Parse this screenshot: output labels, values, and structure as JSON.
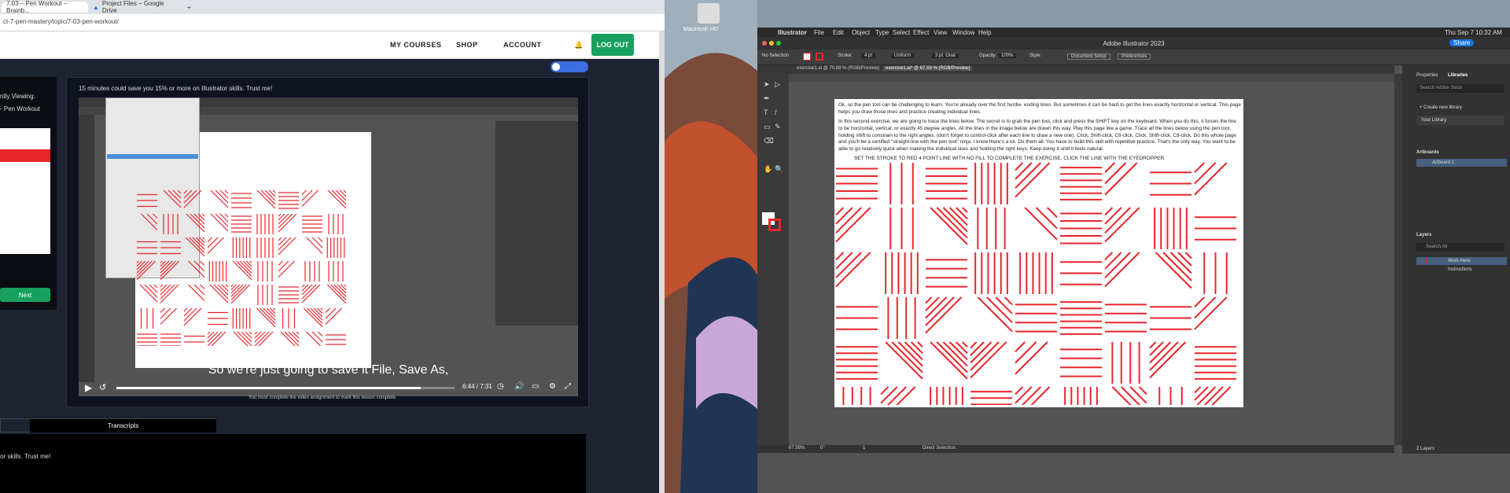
{
  "browser": {
    "tabs": [
      {
        "label": "7.03 – Pen Workout – Brainb..."
      },
      {
        "label": "Project Files – Google Drive"
      }
    ],
    "url": "ct-7-pen-mastery/topic/7-03-pen-workout/"
  },
  "site": {
    "nav": [
      "MY COURSES",
      "SHOP",
      "ACCOUNT"
    ],
    "logout": "LOG OUT",
    "promo": "15 minutes could save you 15% or more on Illustrator skills. Trust me!",
    "sidebar": {
      "viewing": "ntly Viewing:",
      "lesson": "- Pen Workout",
      "next": "Next"
    },
    "video": {
      "caption": "So we're just going to save it File, Save As,",
      "time": "6:44 / 7:31",
      "progress_fraction": 0.9
    },
    "note": "You must complete the video assignment to mark this lesson complete.",
    "transcripts": "Transcripts",
    "lower_text": "or skills. Trust me!"
  },
  "desktop": {
    "label": "Macintosh HD"
  },
  "illustrator": {
    "menu": [
      "Illustrator",
      "File",
      "Edit",
      "Object",
      "Type",
      "Select",
      "Effect",
      "View",
      "Window",
      "Help"
    ],
    "clock": "Thu Sep 7 10:32 AM",
    "title": "Adobe Illustrator 2023",
    "controls": {
      "selection": "No Selection",
      "stroke_label": "Stroke:",
      "stroke_weight": "4 pt",
      "uniform": "Uniform",
      "brush": "3 pt. Oval",
      "opacity_label": "Opacity:",
      "opacity": "100%",
      "style_label": "Style:",
      "doc_setup": "Document Setup",
      "prefs": "Preferences"
    },
    "doc_tabs": [
      "exercise1.ai @ 70.89 % (RGB/Preview)",
      "exercise1.ai* @ 67.59 % (RGB/Preview)"
    ],
    "panels": {
      "tabs": [
        "Properties",
        "Libraries"
      ],
      "search": "Search Adobe Stock",
      "create_library": "+ Create new library",
      "your_library": "Your Library",
      "artboards_title": "Artboards",
      "artboard1": "Artboard 1",
      "layers_title": "Layers",
      "search_all": "Search All",
      "layers": [
        "Work Here",
        "Instructions"
      ],
      "layers_count": "2 Layers"
    },
    "artboard_text": {
      "p1": "Ok, so the pen tool can be challenging to learn. You're already over the first hurdle- ending lines. But sometimes it can be hard to get the lines exactly horizontal or vertical. This page helps you draw those lines and practice creating individual lines.",
      "p2": "In this second exercise, we are going to trace the lines below. The secret is to grab the pen tool, click and press the SHIFT key on the keyboard. When you do this, it forces the line to be horizontal, vertical, or exactly 45 degree angles. All the lines in the image below are drawn this way. Play this page like a game. Trace all the lines below using the pen tool, holding shift to constrain to the right angles. (don't forget to control-click after each line to draw a new one). Click, Shift-click, Ctl-click. Click, Shift-click, Ctl-click. Do this whole page and you'll be a certified \"straight-line with the pen tool\" ninja. I know there's a lot. Do them all. You have to build this skill with repetitive practice. That's the only way. You want to be able to go relatively quick when making the individual lines and holding the right keys. Keep doing it until it feels natural.",
      "instruction": "SET THE STROKE TO RED 4 POINT LINE WITH NO FILL TO COMPLETE THE EXERCISE. CLICK THE LINE WITH THE EYEDROPPER."
    },
    "status": {
      "zoom": "67.59%",
      "angle": "0°",
      "page": "1",
      "tool": "Direct Selection"
    },
    "accent_red": "#e8262c"
  }
}
